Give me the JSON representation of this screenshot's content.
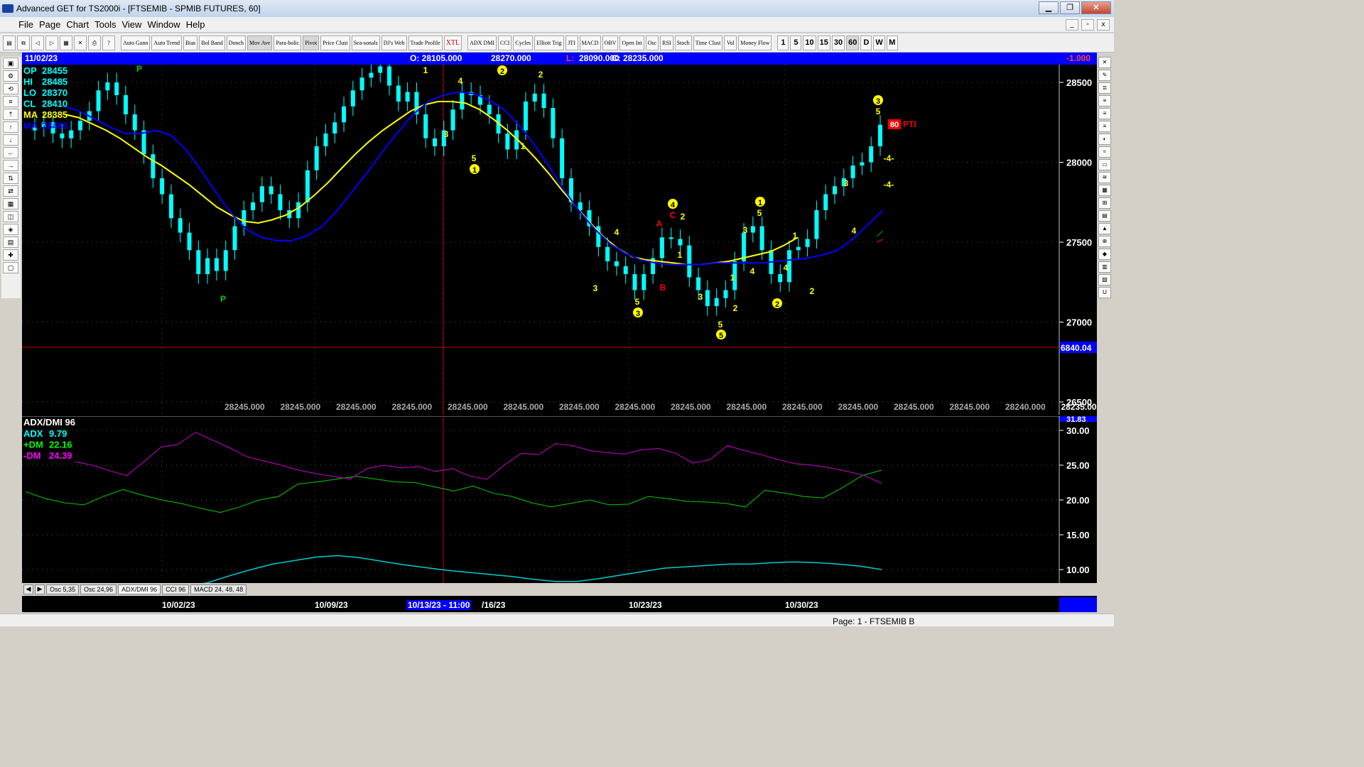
{
  "window": {
    "title": "Advanced GET for TS2000i - [FTSEMIB - SPMIB FUTURES, 60]",
    "min": "▁",
    "max": "❐",
    "close": "✕"
  },
  "menu": [
    "File",
    "Page",
    "Chart",
    "Tools",
    "View",
    "Window",
    "Help"
  ],
  "toolbar": {
    "study_buttons": [
      "Auto Gann",
      "Auto Trend",
      "Bias",
      "Bol Band",
      "Donch",
      "Mov Ave",
      "Para-bolic",
      "Pivot",
      "Price Clust",
      "Sea-sonals",
      "DJ's Web",
      "Trade Profile",
      "XTL",
      "ADX DMI",
      "CCI",
      "Cycles",
      "Elliott Trig",
      "JTI",
      "MACD",
      "OBV",
      "Open Int",
      "Osc",
      "RSI",
      "Stoch",
      "Time Clust",
      "Vol",
      "Money Flow"
    ],
    "intervals": [
      "1",
      "5",
      "10",
      "15",
      "30",
      "60",
      "D",
      "W",
      "M"
    ],
    "selected_interval": "60"
  },
  "infobar": {
    "date": "11/02/23",
    "open": "O: 28105.000",
    "high": "28270.000",
    "low_label": "L:",
    "low": "28090.000",
    "close": "C: 28235.000",
    "change": "-1.000"
  },
  "price_panel": {
    "readouts": [
      {
        "label": "OP",
        "value": "28455",
        "color": "#00ffff"
      },
      {
        "label": "HI",
        "value": "28485",
        "color": "#00ffff"
      },
      {
        "label": "LO",
        "value": "28370",
        "color": "#00ffff"
      },
      {
        "label": "CL",
        "value": "28410",
        "color": "#00ffff"
      },
      {
        "label": "MA",
        "value": "28385",
        "color": "#ffff00"
      },
      {
        "label": "MA",
        "value": "28486",
        "color": "#0000ff"
      }
    ],
    "y_ticks": [
      "28500",
      "28000",
      "27500",
      "27000",
      "26500"
    ],
    "cursor_price": "6840.04",
    "scroll_values": [
      "28245.000",
      "28245.000",
      "28245.000",
      "28245.000",
      "28245.000",
      "28245.000",
      "28245.000",
      "28245.000",
      "28245.000",
      "28245.000",
      "28245.000",
      "28245.000",
      "28245.000",
      "28245.000",
      "28240.000",
      "28235.000"
    ],
    "pti_value": "80",
    "pti_label": "PTI",
    "wave_labels": [
      {
        "t": "P",
        "c": "#00cc00",
        "k": "plain"
      },
      {
        "t": "P",
        "c": "#00cc00",
        "k": "plain"
      },
      {
        "t": "1",
        "c": "#ffff00",
        "k": "plain"
      },
      {
        "t": "4",
        "c": "#ffff00",
        "k": "plain"
      },
      {
        "t": "2",
        "c": "#ffff00",
        "k": "circle"
      },
      {
        "t": "2",
        "c": "#ffff00",
        "k": "plain"
      },
      {
        "t": "3",
        "c": "#ffff00",
        "k": "plain"
      },
      {
        "t": "5",
        "c": "#ffff00",
        "k": "plain"
      },
      {
        "t": "1",
        "c": "#ffff00",
        "k": "circle"
      },
      {
        "t": "1",
        "c": "#ffff00",
        "k": "plain"
      },
      {
        "t": "4",
        "c": "#ffff00",
        "k": "circle"
      },
      {
        "t": "C",
        "c": "#ff0000",
        "k": "plain"
      },
      {
        "t": "2",
        "c": "#ffff00",
        "k": "plain"
      },
      {
        "t": "A",
        "c": "#ff0000",
        "k": "plain"
      },
      {
        "t": "4",
        "c": "#ffff00",
        "k": "plain"
      },
      {
        "t": "1",
        "c": "#ffff00",
        "k": "plain"
      },
      {
        "t": "3",
        "c": "#ffff00",
        "k": "plain"
      },
      {
        "t": "5",
        "c": "#ffff00",
        "k": "plain"
      },
      {
        "t": "3",
        "c": "#ffff00",
        "k": "circle"
      },
      {
        "t": "B",
        "c": "#ff0000",
        "k": "plain"
      },
      {
        "t": "3",
        "c": "#ffff00",
        "k": "plain"
      },
      {
        "t": "4",
        "c": "#ffff00",
        "k": "plain"
      },
      {
        "t": "1",
        "c": "#ffff00",
        "k": "plain"
      },
      {
        "t": "2",
        "c": "#ffff00",
        "k": "plain"
      },
      {
        "t": "5",
        "c": "#ffff00",
        "k": "plain"
      },
      {
        "t": "5",
        "c": "#ffff00",
        "k": "circle"
      },
      {
        "t": "1",
        "c": "#ffff00",
        "k": "circle"
      },
      {
        "t": "5",
        "c": "#ffff00",
        "k": "plain"
      },
      {
        "t": "3",
        "c": "#ffff00",
        "k": "plain"
      },
      {
        "t": "4",
        "c": "#ffff00",
        "k": "plain"
      },
      {
        "t": "1",
        "c": "#ffff00",
        "k": "plain"
      },
      {
        "t": "2",
        "c": "#ffff00",
        "k": "circle"
      },
      {
        "t": "2",
        "c": "#ffff00",
        "k": "plain"
      },
      {
        "t": "3",
        "c": "#ffff00",
        "k": "plain"
      },
      {
        "t": "4",
        "c": "#ffff00",
        "k": "plain"
      },
      {
        "t": "3",
        "c": "#ffff00",
        "k": "circle"
      },
      {
        "t": "5",
        "c": "#ffff00",
        "k": "plain"
      },
      {
        "t": "-4-",
        "c": "#ffff00",
        "k": "plain"
      },
      {
        "t": "-4-",
        "c": "#ffff00",
        "k": "plain"
      }
    ]
  },
  "indicator_panel": {
    "title": "ADX/DMI 96",
    "readouts": [
      {
        "label": "ADX",
        "value": "9.79",
        "color": "#00ffff"
      },
      {
        "label": "+DM",
        "value": "22.16",
        "color": "#00ff00"
      },
      {
        "label": "-DM",
        "value": "24.39",
        "color": "#ff00ff"
      }
    ],
    "y_ticks": [
      "30.00",
      "25.00",
      "20.00",
      "15.00",
      "10.00"
    ],
    "top_value": "31.83"
  },
  "tabs": [
    "Osc 5,35",
    "Osc 24,96",
    "ADX/DMI 96",
    "CCI 96",
    "MACD 24, 48, 48"
  ],
  "active_tab": "ADX/DMI 96",
  "dates": [
    "10/02/23",
    "10/09/23",
    "10/13/23 - 11:00",
    "/16/23",
    "10/23/23",
    "10/30/23"
  ],
  "status": "Page: 1 - FTSEMIB B",
  "chart_data": {
    "type": "line",
    "price": {
      "ylim": [
        26500,
        28500
      ],
      "close": [
        28220,
        28250,
        28180,
        28150,
        28200,
        28260,
        28320,
        28450,
        28500,
        28420,
        28300,
        28200,
        28050,
        27900,
        27800,
        27650,
        27560,
        27450,
        27300,
        27400,
        27320,
        27450,
        27600,
        27700,
        27750,
        27850,
        27800,
        27700,
        27650,
        27750,
        27950,
        28100,
        28180,
        28250,
        28350,
        28450,
        28530,
        28560,
        28600,
        28480,
        28380,
        28440,
        28300,
        28150,
        28100,
        28200,
        28330,
        28440,
        28420,
        28360,
        28300,
        28180,
        28080,
        28200,
        28380,
        28430,
        28340,
        28150,
        27900,
        27750,
        27700,
        27600,
        27470,
        27380,
        27350,
        27300,
        27200,
        27300,
        27400,
        27530,
        27520,
        27480,
        27280,
        27200,
        27100,
        27150,
        27200,
        27380,
        27560,
        27600,
        27450,
        27300,
        27250,
        27450,
        27470,
        27520,
        27700,
        27800,
        27850,
        27900,
        27980,
        28000,
        28100,
        28235
      ],
      "ma_yellow": [
        28300,
        28280,
        28240,
        28200,
        28150,
        28090,
        28030,
        27980,
        27920,
        27860,
        27790,
        27720,
        27670,
        27630,
        27620,
        27640,
        27670,
        27720,
        27790,
        27870,
        27960,
        28050,
        28130,
        28200,
        28260,
        28320,
        28360,
        28380,
        28380,
        28370,
        28330,
        28270,
        28200,
        28120,
        28030,
        27930,
        27820,
        27720,
        27620,
        27530,
        27460,
        27410,
        27390,
        27380,
        27370,
        27360,
        27360,
        27370,
        27380,
        27400,
        27420,
        27440,
        27480,
        27530
      ],
      "ma_blue": [
        28350,
        28320,
        28270,
        28220,
        28180,
        28180,
        28200,
        28170,
        28080,
        27950,
        27810,
        27680,
        27580,
        27530,
        27510,
        27510,
        27540,
        27600,
        27700,
        27820,
        27940,
        28070,
        28190,
        28300,
        28380,
        28420,
        28440,
        28430,
        28390,
        28330,
        28230,
        28110,
        27970,
        27820,
        27690,
        27580,
        27490,
        27430,
        27390,
        27370,
        27360,
        27360,
        27360,
        27370,
        27370,
        27370,
        27370,
        27380,
        27390,
        27400,
        27420,
        27450,
        27520,
        27610,
        27700
      ]
    },
    "adx_dmi": {
      "ylim": [
        7,
        32
      ],
      "plus_dm": [
        21.2,
        20.2,
        19.6,
        19.3,
        20.5,
        21.5,
        20.7,
        20.0,
        19.5,
        18.8,
        18.2,
        19.0,
        20.0,
        20.5,
        22.3,
        22.6,
        23.0,
        23.4,
        23.0,
        22.6,
        22.5,
        21.9,
        21.3,
        22.0,
        21.0,
        20.5,
        19.6,
        19.0,
        19.5,
        20.0,
        19.3,
        19.4,
        20.5,
        20.2,
        19.8,
        19.7,
        19.5,
        19.0,
        21.4,
        21.0,
        20.5,
        20.3,
        21.8,
        23.5,
        24.3
      ],
      "minus_dm": [
        25.5,
        25.0,
        24.2,
        23.5,
        25.5,
        27.6,
        28.0,
        29.7,
        28.6,
        27.5,
        26.2,
        25.6,
        25.0,
        24.3,
        23.8,
        23.4,
        23.0,
        24.5,
        25.0,
        24.6,
        24.8,
        24.1,
        24.5,
        23.4,
        23.0,
        25.0,
        26.7,
        26.5,
        28.1,
        27.8,
        27.1,
        26.8,
        26.6,
        27.2,
        27.4,
        26.7,
        25.3,
        25.8,
        27.8,
        27.1,
        26.5,
        25.8,
        25.2,
        25.0,
        24.6,
        24.1,
        23.5,
        22.4
      ],
      "adx": [
        7.2,
        7.6,
        8.1,
        9.1,
        10.0,
        10.8,
        11.3,
        11.8,
        12.0,
        11.7,
        11.2,
        10.7,
        10.3,
        9.9,
        9.6,
        9.3,
        9.0,
        8.6,
        8.3,
        8.3,
        8.7,
        9.2,
        9.7,
        10.2,
        10.4,
        10.6,
        10.8,
        10.8,
        11.0,
        11.1,
        11.0,
        10.8,
        10.5,
        10.0
      ]
    }
  }
}
